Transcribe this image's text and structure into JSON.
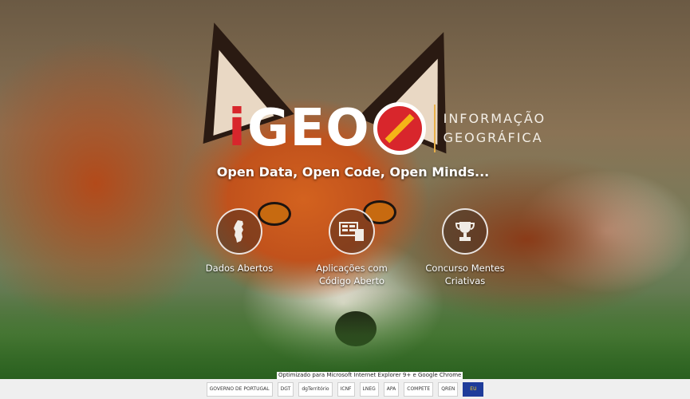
{
  "logo": {
    "letter_i": "i",
    "letters_geo": "GEO",
    "text_line1": "INFORMAÇÃO",
    "text_line2": "GEOGRÁFICA"
  },
  "tagline": "Open Data, Open Code, Open Minds...",
  "features": [
    {
      "icon": "portugal-map-icon",
      "label": "Dados Abertos"
    },
    {
      "icon": "apps-icon",
      "label_line1": "Aplicações com",
      "label_line2": "Código Aberto"
    },
    {
      "icon": "trophy-icon",
      "label_line1": "Concurso Mentes",
      "label_line2": "Criativas"
    }
  ],
  "browser_note": "Optimizado para Microsoft Internet Explorer 9+ e Google Chrome",
  "sponsors": [
    "GOVERNO DE PORTUGAL",
    "DGT",
    "dgTerritório",
    "ICNF",
    "LNEG",
    "APA",
    "COMPETE",
    "QREN",
    "EU"
  ],
  "colors": {
    "brand_red": "#d8262c",
    "accent_gold": "#e8b04a"
  }
}
